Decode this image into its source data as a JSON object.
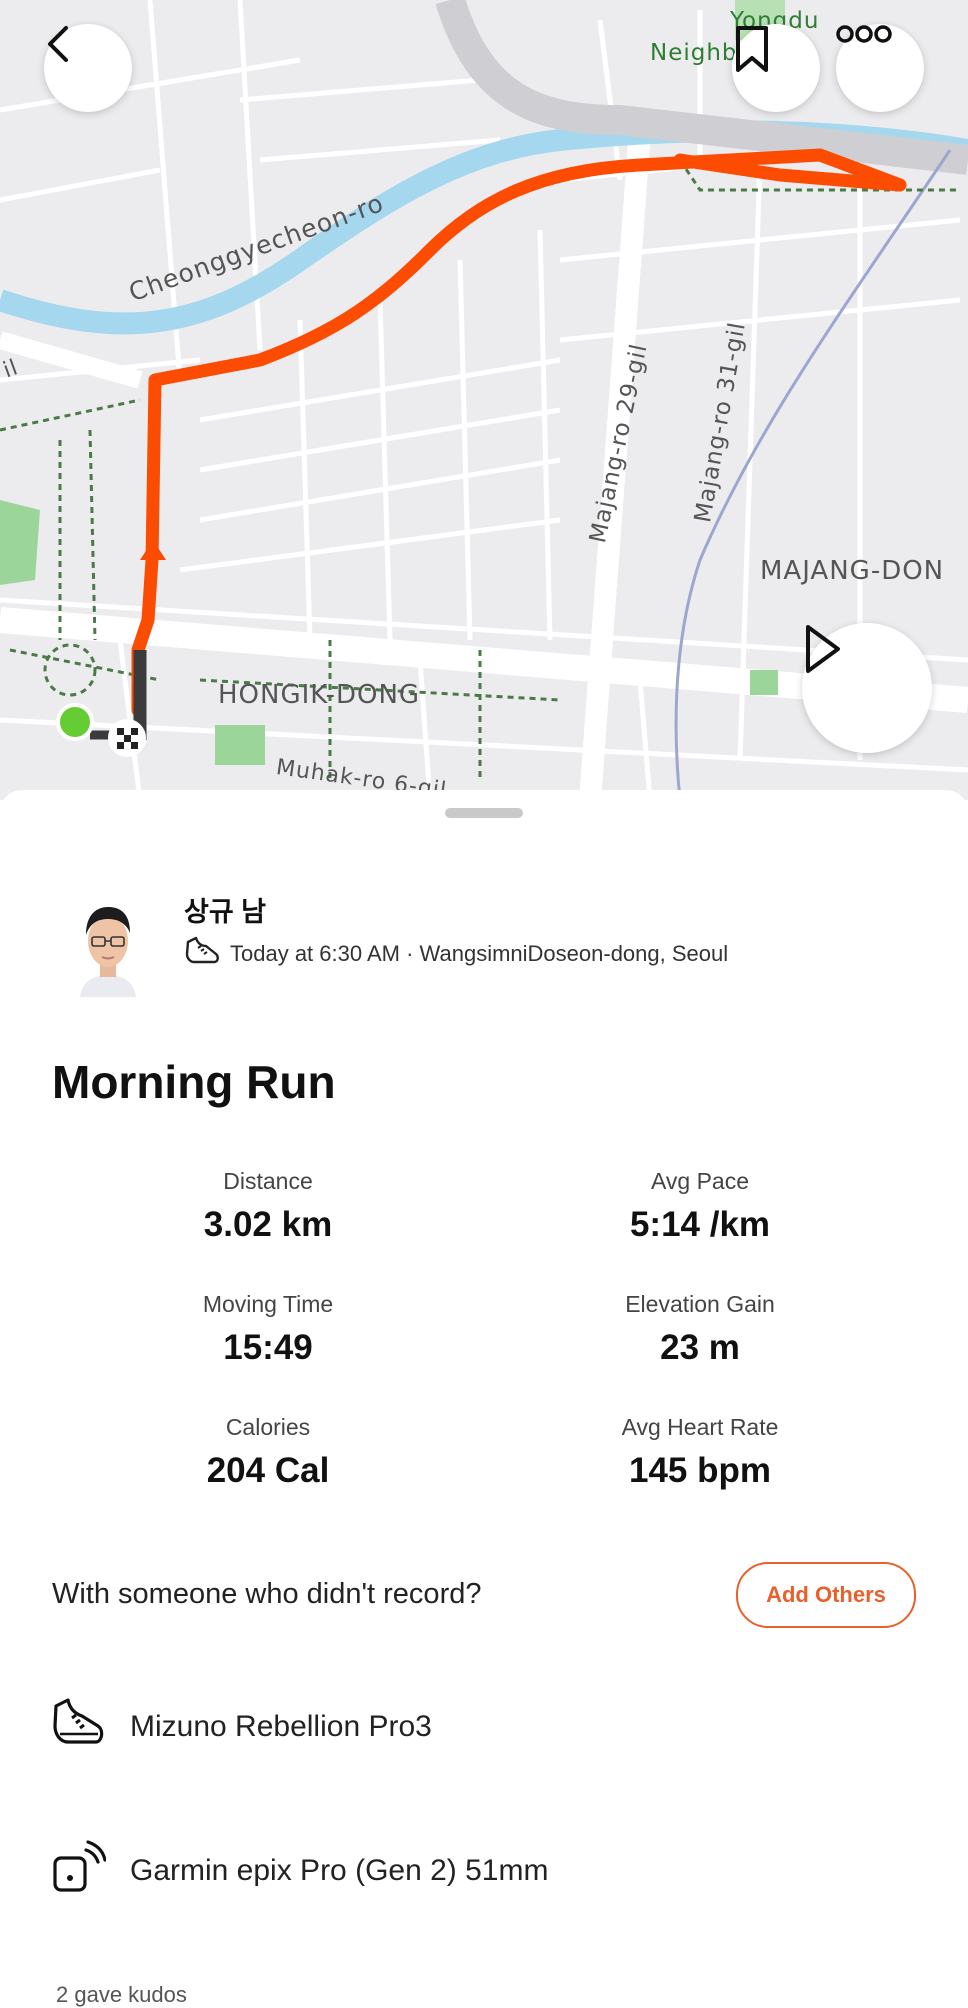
{
  "map": {
    "labels": {
      "neighborhood_top": "Yongdu",
      "neighborhood_top2": "Neighb",
      "road1": "Cheonggyecheon-ro",
      "road2": "Majang-ro 29-gil",
      "road3": "Majang-ro 31-gil",
      "district1": "HONGIK-DONG",
      "district2": "MAJANG-DON",
      "road4": "Muhak-ro 6-gil",
      "road5": "il"
    },
    "route_color": "#fc4c02"
  },
  "toolbar": {
    "back_icon": "chevron-left-icon",
    "save_icon": "bookmark-icon",
    "more_icon": "more-dots-icon",
    "play_icon": "play-icon"
  },
  "activity": {
    "athlete_name": "상규 남",
    "sport_icon": "running-shoe-icon",
    "meta": "Today at 6:30 AM · WangsimniDoseon-dong, Seoul",
    "title": "Morning Run"
  },
  "stats": [
    {
      "label": "Distance",
      "value": "3.02 km"
    },
    {
      "label": "Avg Pace",
      "value": "5:14 /km"
    },
    {
      "label": "Moving Time",
      "value": "15:49"
    },
    {
      "label": "Elevation Gain",
      "value": "23 m"
    },
    {
      "label": "Calories",
      "value": "204 Cal"
    },
    {
      "label": "Avg Heart Rate",
      "value": "145 bpm"
    }
  ],
  "with_others": {
    "prompt": "With someone who didn't record?",
    "button": "Add Others"
  },
  "gear": {
    "shoe": "Mizuno Rebellion Pro3",
    "device": "Garmin epix Pro (Gen 2) 51mm"
  },
  "kudos": "2 gave kudos",
  "colors": {
    "accent": "#fc4c02",
    "button_text": "#e8602c"
  }
}
